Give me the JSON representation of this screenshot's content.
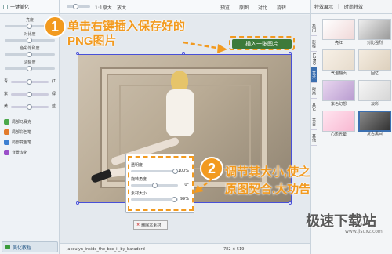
{
  "left_panel": {
    "auto_label": "一键美化",
    "sliders": [
      "亮度",
      "对比度",
      "色彩饱和度",
      "清晰度"
    ],
    "rgb": [
      {
        "left": "青",
        "right": "红"
      },
      {
        "left": "紫",
        "right": "绿"
      },
      {
        "left": "黄",
        "right": "蓝"
      }
    ],
    "tools": [
      {
        "label": "局部马赛克",
        "color": "#4aa84a"
      },
      {
        "label": "局部彩色笔",
        "color": "#e27a2a"
      },
      {
        "label": "局部变色笔",
        "color": "#3b7fd0"
      },
      {
        "label": "背景虚化",
        "color": "#9a4fc9"
      }
    ],
    "footer": "美化教程"
  },
  "toolbar": {
    "zoom": "1:1原大",
    "zoom_in": "放大",
    "preview": "预览",
    "original": "原图",
    "compare": "对比",
    "rotate": "旋转"
  },
  "annotations": {
    "step1_num": "1",
    "step1_line1": "单击右键插入保存好的",
    "step1_line2": "PNG图片",
    "insert_button": "插入一张图片",
    "step2_num": "2",
    "step2_line1": "调节其大小,使之与",
    "step2_line2": "原图契合,大功告成!"
  },
  "material_panel": {
    "rows": [
      {
        "label": "透明度",
        "value": "100%"
      },
      {
        "label": "旋转角度",
        "value": "0°"
      },
      {
        "label": "素材大小",
        "value": "99%"
      }
    ],
    "delete_label": "删除本素材"
  },
  "status": {
    "filename": "jacqulyn_inside_the_box_ii_by_baraderd",
    "size": "782 × 519"
  },
  "right_panel": {
    "tab_effects": "特效展示",
    "tab_fashion": "时尚特效",
    "side_tabs": [
      "热门",
      "影楼",
      "LOMO",
      "艺术",
      "时尚",
      "其它",
      "节日",
      "其他"
    ],
    "thumbs": [
      "亮红",
      "对比强烈",
      "气泡翻页",
      "回忆",
      "紫色幻想",
      "淡彩",
      "心形光晕",
      "复古黑白"
    ]
  },
  "watermark": "极速下载站",
  "watermark_url": "www.jisuxz.com"
}
